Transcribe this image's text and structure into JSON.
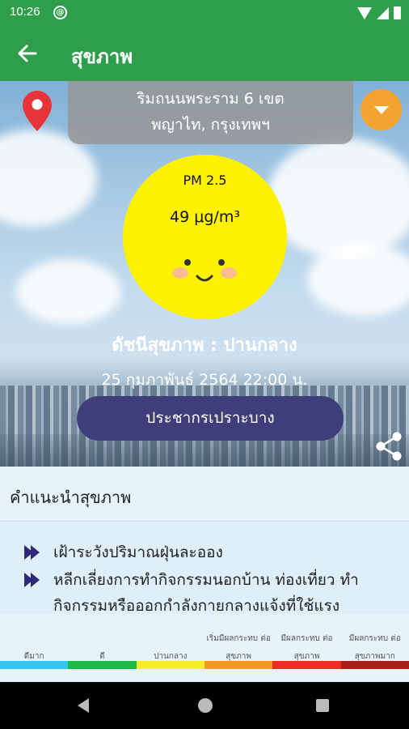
{
  "status_bar": {
    "time": "10:26",
    "app_icon_glyph": "@"
  },
  "app_bar": {
    "title": "สุขภาพ",
    "back_icon": "arrow-back-icon"
  },
  "location": {
    "line1": "ริมถนนพระราม 6 เขต",
    "line2": "พญาไท, กรุงเทพฯ"
  },
  "aqi": {
    "label": "PM 2.5",
    "value": "49 μg/m³",
    "color": "#fff200"
  },
  "health_index": "ดัชนีสุขภาพ : ปานกลาง",
  "timestamp": "25 กุมภาพันธ์ 2564 22:00 น.",
  "group_button": "ประชากรเปราะบาง",
  "advice": {
    "title": "คำแนะนำสุขภาพ",
    "items": [
      "เฝ้าระวังปริมาณฝุ่นละออง",
      "หลีกเลี่ยงการทำกิจกรรมนอกบ้าน ท่องเที่ยว ทำ",
      "กิจกรรมหรือออกกำลังกายกลางแจ้งที่ใช้แรง"
    ]
  },
  "scale": {
    "labels": [
      "ดีมาก",
      "ดี",
      "ปานกลาง",
      "เริ่มมีผลกระทบ ต่อสุขภาพ",
      "มีผลกระทบ ต่อสุขภาพ",
      "มีผลกระทบ ต่อสุขภาพมาก"
    ],
    "colors": [
      "#33c4f0",
      "#1fb84a",
      "#f7ef2a",
      "#f39a22",
      "#ee2c22",
      "#a8201e"
    ]
  }
}
